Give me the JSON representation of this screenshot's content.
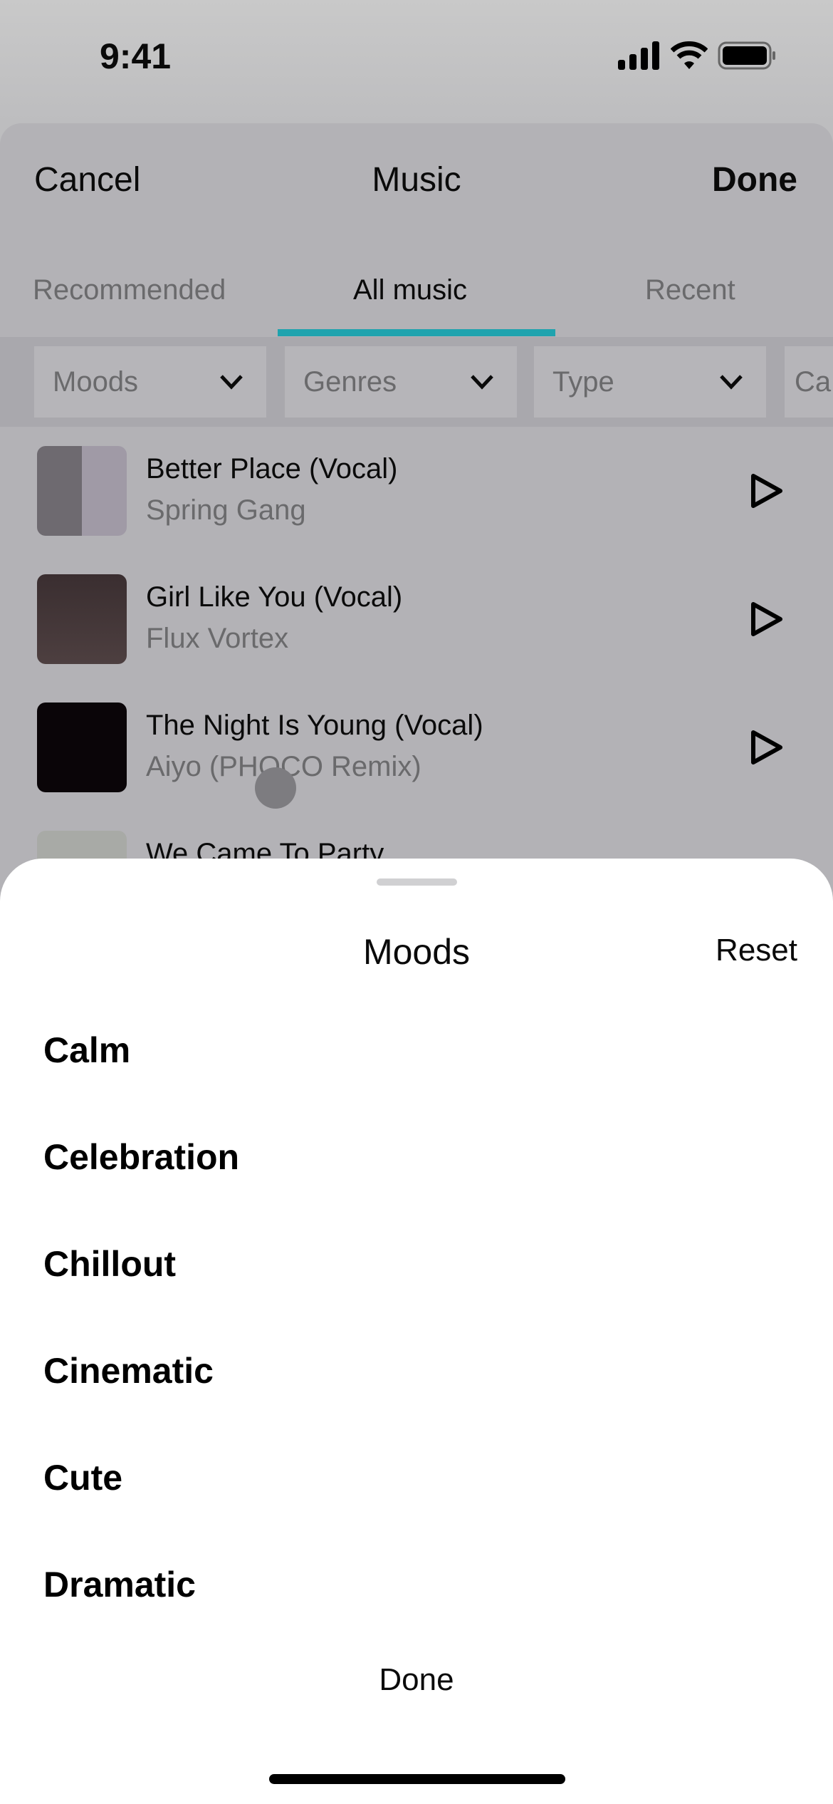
{
  "status": {
    "time": "9:41"
  },
  "header": {
    "cancel": "Cancel",
    "title": "Music",
    "done": "Done"
  },
  "tabs": [
    {
      "label": "Recommended"
    },
    {
      "label": "All music",
      "active": true
    },
    {
      "label": "Recent"
    }
  ],
  "colors": {
    "accent": "#1fa3ae"
  },
  "filters": [
    {
      "label": "Moods"
    },
    {
      "label": "Genres"
    },
    {
      "label": "Type"
    },
    {
      "label": "Ca"
    }
  ],
  "tracks": [
    {
      "title": "Better Place (Vocal)",
      "artist": "Spring Gang"
    },
    {
      "title": "Girl Like You (Vocal)",
      "artist": "Flux Vortex"
    },
    {
      "title": "The Night Is Young (Vocal)",
      "artist": "Aiyo (PHOCO Remix)"
    },
    {
      "title": "We Came To Party",
      "artist": ""
    }
  ],
  "moods_sheet": {
    "title": "Moods",
    "reset": "Reset",
    "done": "Done",
    "items": [
      "Calm",
      "Celebration",
      "Chillout",
      "Cinematic",
      "Cute",
      "Dramatic"
    ]
  }
}
